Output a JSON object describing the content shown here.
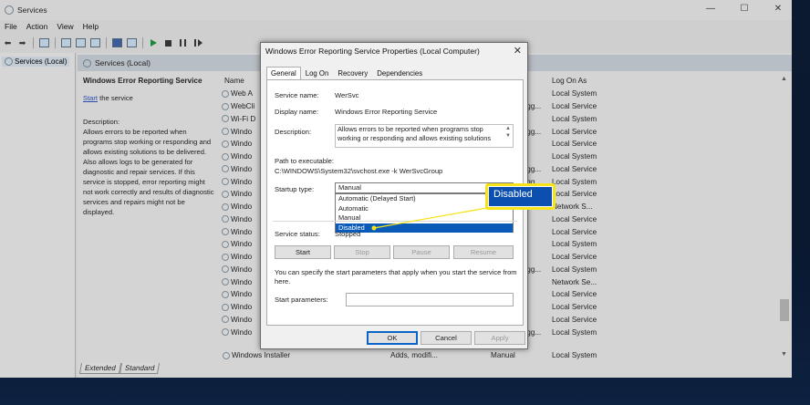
{
  "window": {
    "title": "Services",
    "controls": {
      "minimize": "—",
      "maximize": "☐",
      "close": "✕"
    }
  },
  "menu": [
    "File",
    "Action",
    "View",
    "Help"
  ],
  "tree": {
    "root": "Services (Local)"
  },
  "pane": {
    "header": "Services (Local)",
    "selected_service": "Windows Error Reporting Service",
    "start_link": "Start",
    "start_suffix": " the service",
    "description_label": "Description:",
    "description": "Allows errors to be reported when programs stop working or responding and allows existing solutions to be delivered. Also allows logs to be generated for diagnostic and repair services. If this service is stopped, error reporting might not work correctly and results of diagnostic services and repairs might not be displayed."
  },
  "columns": {
    "name": "Name",
    "log_on_as": "Log On As"
  },
  "rows": [
    {
      "name": "Web A",
      "startup": "",
      "logon": "Local System"
    },
    {
      "name": "WebCli",
      "startup": "ıgg...",
      "logon": "Local Service"
    },
    {
      "name": "Wi-Fi D",
      "startup": "",
      "logon": "Local System"
    },
    {
      "name": "Windo",
      "startup": "ıgg...",
      "logon": "Local Service"
    },
    {
      "name": "Windo",
      "startup": "",
      "logon": "Local Service"
    },
    {
      "name": "Windo",
      "startup": "",
      "logon": "Local System"
    },
    {
      "name": "Windo",
      "startup": "ıgg...",
      "logon": "Local Service"
    },
    {
      "name": "Windo",
      "startup": "ıgg...",
      "logon": "Local System"
    },
    {
      "name": "Windo",
      "startup": "",
      "logon": "Local Service"
    },
    {
      "name": "Windo",
      "startup": "",
      "logon": "Network S..."
    },
    {
      "name": "Windo",
      "startup": "",
      "logon": "Local Service"
    },
    {
      "name": "Windo",
      "startup": "",
      "logon": "Local Service"
    },
    {
      "name": "Windo",
      "startup": "",
      "logon": "Local System"
    },
    {
      "name": "Windo",
      "startup": "",
      "logon": "Local Service"
    },
    {
      "name": "Windo",
      "startup": "ıgg...",
      "logon": "Local System"
    },
    {
      "name": "Windo",
      "startup": "",
      "logon": "Network Se..."
    },
    {
      "name": "Windo",
      "startup": "",
      "logon": "Local Service"
    },
    {
      "name": "Windo",
      "startup": "",
      "logon": "Local Service"
    },
    {
      "name": "Windo",
      "startup": "",
      "logon": "Local Service"
    },
    {
      "name": "Windo",
      "startup": "ıgg...",
      "logon": "Local System"
    }
  ],
  "last_row": {
    "name": "Windows Installer",
    "description": "Adds, modifi...",
    "startup": "Manual",
    "logon": "Local System"
  },
  "bottom_tabs": [
    "Extended",
    "Standard"
  ],
  "dialog": {
    "title": "Windows Error Reporting Service Properties (Local Computer)",
    "close": "✕",
    "tabs": [
      "General",
      "Log On",
      "Recovery",
      "Dependencies"
    ],
    "service_name_label": "Service name:",
    "service_name": "WerSvc",
    "display_name_label": "Display name:",
    "display_name": "Windows Error Reporting Service",
    "description_label": "Description:",
    "description": "Allows errors to be reported when programs stop working or responding and allows existing solutions",
    "path_label": "Path to executable:",
    "path": "C:\\WINDOWS\\System32\\svchost.exe -k WerSvcGroup",
    "startup_type_label": "Startup type:",
    "startup_type": "Manual",
    "startup_options": [
      "Automatic (Delayed Start)",
      "Automatic",
      "Manual",
      "Disabled"
    ],
    "selected_option": "Disabled",
    "service_status_label": "Service status:",
    "service_status": "Stopped",
    "buttons": {
      "start": "Start",
      "stop": "Stop",
      "pause": "Pause",
      "resume": "Resume"
    },
    "params_note": "You can specify the start parameters that apply when you start the service from here.",
    "start_params_label": "Start parameters:",
    "ok": "OK",
    "cancel": "Cancel",
    "apply": "Apply"
  },
  "callout": {
    "text": "Disabled",
    "color": "#f7e31a",
    "fill": "#0b4fb0"
  }
}
